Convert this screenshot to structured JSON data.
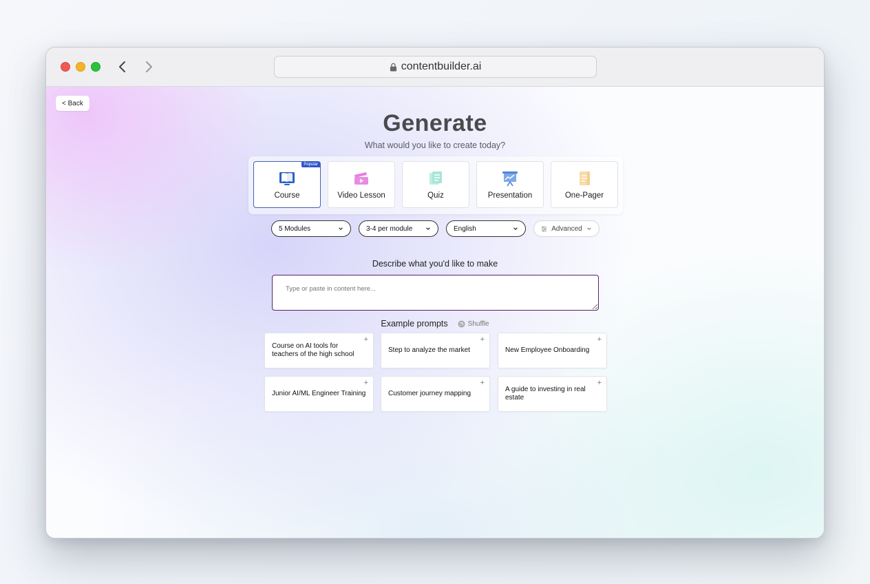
{
  "browser": {
    "url": "contentbuilder.ai"
  },
  "page": {
    "back_label": "< Back",
    "title": "Generate",
    "subtitle": "What would you like to create today?"
  },
  "content_types": [
    {
      "label": "Course",
      "icon": "book-icon",
      "selected": true,
      "badge": "Popular"
    },
    {
      "label": "Video Lesson",
      "icon": "video-icon",
      "selected": false
    },
    {
      "label": "Quiz",
      "icon": "quiz-icon",
      "selected": false
    },
    {
      "label": "Presentation",
      "icon": "presentation-icon",
      "selected": false
    },
    {
      "label": "One-Pager",
      "icon": "document-icon",
      "selected": false
    }
  ],
  "options": {
    "modules": "5 Modules",
    "per_module": "3-4 per module",
    "language": "English",
    "advanced": "Advanced"
  },
  "prompt": {
    "label": "Describe what you'd like to make",
    "placeholder": "Type or paste in content here..."
  },
  "examples": {
    "label": "Example prompts",
    "shuffle": "Shuffle",
    "items": [
      "Course on AI tools for teachers of the high school",
      "Step to analyze the market",
      "New Employee Onboarding",
      "Junior AI/ML Engineer Training",
      "Customer journey mapping",
      "A guide to investing in real estate"
    ]
  },
  "colors": {
    "accent": "#3e62b5",
    "prompt_border": "#5b1f6e",
    "badge": "#2f57c9"
  }
}
